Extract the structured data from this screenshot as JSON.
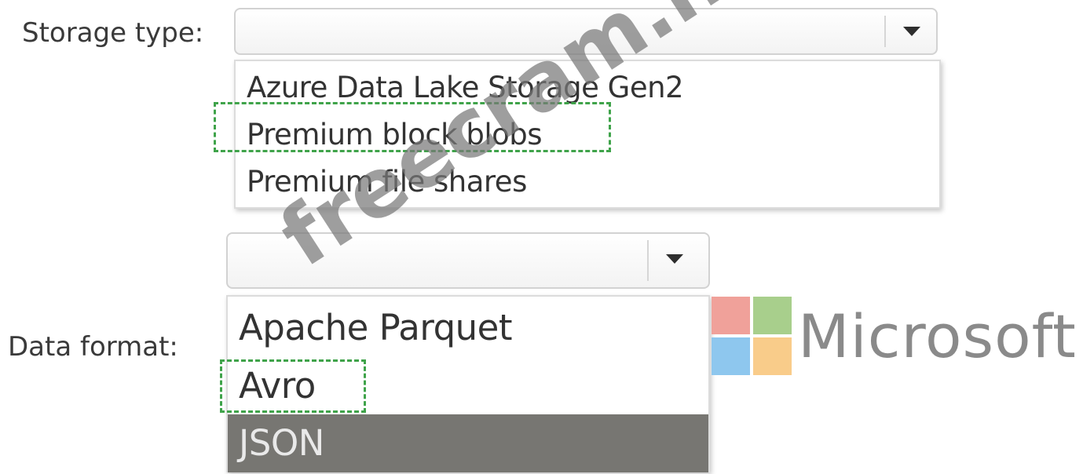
{
  "storage": {
    "label": "Storage type:",
    "selected_value": "",
    "options": [
      "Azure Data Lake Storage Gen2",
      "Premium block blobs",
      "Premium file shares"
    ]
  },
  "format": {
    "label": "Data format:",
    "selected_value": "",
    "options": [
      "Apache Parquet",
      "Avro",
      "JSON"
    ]
  },
  "branding": {
    "word": "Microsoft",
    "logo_colors": [
      "#f25022",
      "#7fba00",
      "#00a4ef",
      "#ffb900"
    ]
  },
  "watermark": {
    "text": "freecram.net"
  },
  "colors": {
    "answer_marker": "#3fa34a",
    "selected_row": "#777672"
  }
}
